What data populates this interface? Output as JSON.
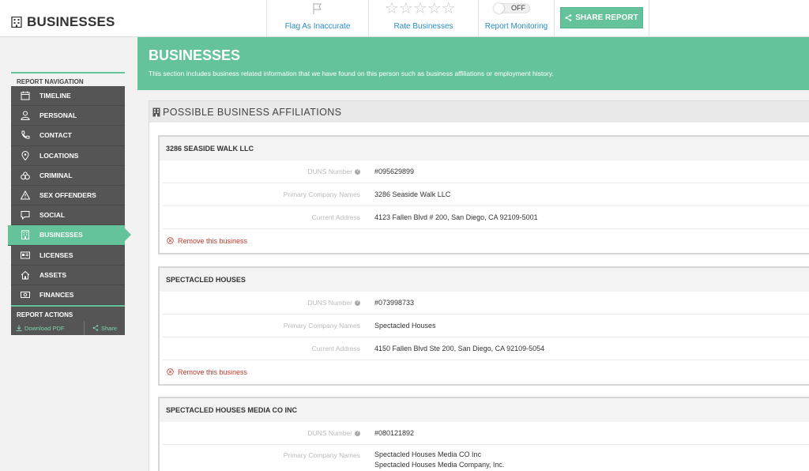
{
  "header": {
    "title": "BUSINESSES",
    "actions": {
      "flag_label": "Flag As Inaccurate",
      "rate_label": "Rate Businesses",
      "rate_stars": "☆☆☆☆☆",
      "monitor_label": "Report Monitoring",
      "monitor_state": "OFF",
      "share_label": "SHARE REPORT"
    }
  },
  "sidebar": {
    "nav_heading": "REPORT NAVIGATION",
    "items": [
      {
        "label": "TIMELINE",
        "icon": "calendar-icon"
      },
      {
        "label": "PERSONAL",
        "icon": "person-icon"
      },
      {
        "label": "CONTACT",
        "icon": "phone-icon"
      },
      {
        "label": "LOCATIONS",
        "icon": "map-pin-icon"
      },
      {
        "label": "CRIMINAL",
        "icon": "handcuffs-icon"
      },
      {
        "label": "SEX OFFENDERS",
        "icon": "warning-icon"
      },
      {
        "label": "SOCIAL",
        "icon": "chat-icon"
      },
      {
        "label": "BUSINESSES",
        "icon": "building-icon",
        "active": true
      },
      {
        "label": "LICENSES",
        "icon": "id-card-icon"
      },
      {
        "label": "ASSETS",
        "icon": "house-icon"
      },
      {
        "label": "FINANCES",
        "icon": "money-icon"
      }
    ],
    "actions_heading": "REPORT ACTIONS",
    "download_label": "Download PDF",
    "share_label": "Share"
  },
  "hero": {
    "title": "BUSINESSES",
    "description": "This section includes business related information that we have found on this person such as business affiliations or employment history."
  },
  "affiliations": {
    "heading": "POSSIBLE BUSINESS AFFILIATIONS",
    "field_labels": {
      "duns": "DUNS Number",
      "primary_name": "Primary Company Names",
      "address": "Current Address"
    },
    "remove_label": "Remove this business",
    "businesses": [
      {
        "name": "3286 SEASIDE WALK LLC",
        "duns": "#095629899",
        "primary_name": "3286 Seaside Walk LLC",
        "address": "4123 Fallen Blvd # 200, San Diego, CA 92109-5001"
      },
      {
        "name": "SPECTACLED HOUSES",
        "duns": "#073998733",
        "primary_name": "Spectacled Houses",
        "address": "4150 Fallen Blvd Ste 200, San Diego, CA 92109-5054"
      },
      {
        "name": "SPECTACLED HOUSES MEDIA CO INC",
        "duns": "#080121892",
        "primary_name": "Spectacled Houses Media CO Inc",
        "primary_name_2": "Spectacled Houses Media Company, Inc."
      }
    ]
  },
  "colors": {
    "accent": "#64c39a",
    "sidebar_bg": "#555555",
    "link_blue": "#2a8dc6",
    "remove_red": "#c0392b"
  }
}
